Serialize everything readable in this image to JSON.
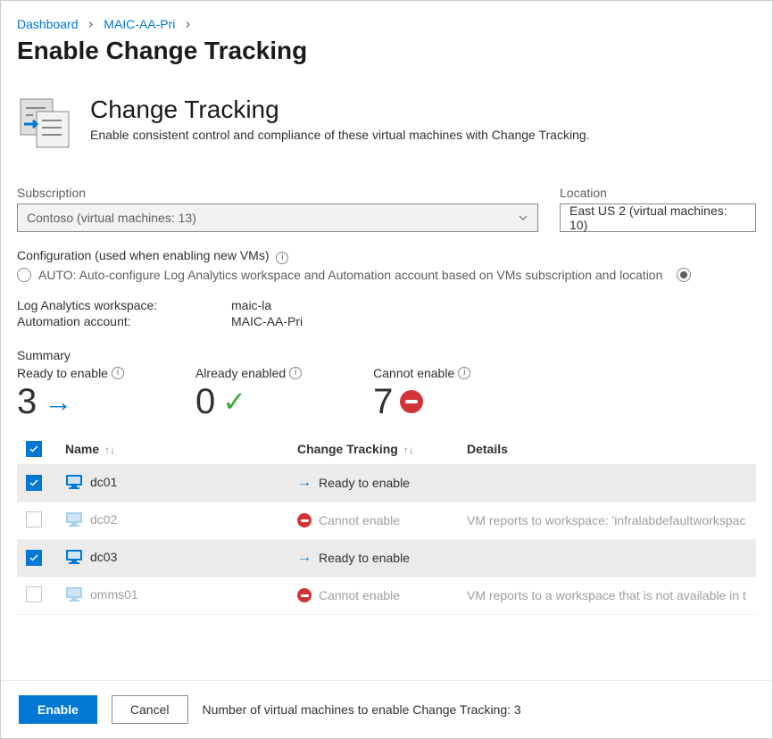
{
  "breadcrumb": {
    "item0": "Dashboard",
    "item1": "MAIC-AA-Pri"
  },
  "pageTitle": "Enable Change Tracking",
  "hero": {
    "title": "Change Tracking",
    "subtitle": "Enable consistent control and compliance of these virtual machines with Change Tracking."
  },
  "fields": {
    "subscription": {
      "label": "Subscription",
      "value": "Contoso  (virtual machines: 13)"
    },
    "location": {
      "label": "Location",
      "value": "East US 2 (virtual machines: 10)"
    }
  },
  "config": {
    "title": "Configuration (used when enabling new VMs)",
    "option": "AUTO: Auto-configure Log Analytics workspace and Automation account based on VMs subscription and location"
  },
  "info": {
    "law_label": "Log Analytics workspace:",
    "law_value": "maic-la",
    "aa_label": "Automation account:",
    "aa_value": "MAIC-AA-Pri"
  },
  "summary": {
    "heading": "Summary",
    "ready": {
      "label": "Ready to enable",
      "value": "3"
    },
    "already": {
      "label": "Already enabled",
      "value": "0"
    },
    "cannot": {
      "label": "Cannot enable",
      "value": "7"
    }
  },
  "table": {
    "col_name": "Name",
    "col_ct": "Change Tracking",
    "col_details": "Details",
    "rows": [
      {
        "name": "dc01",
        "status": "Ready to enable",
        "details": "",
        "checked": true,
        "enabled": true
      },
      {
        "name": "dc02",
        "status": "Cannot enable",
        "details": "VM reports to workspace: 'infralabdefaultworkspac",
        "checked": false,
        "enabled": false
      },
      {
        "name": "dc03",
        "status": "Ready to enable",
        "details": "",
        "checked": true,
        "enabled": true
      },
      {
        "name": "omms01",
        "status": "Cannot enable",
        "details": "VM reports to a workspace that is not available in t",
        "checked": false,
        "enabled": false
      }
    ]
  },
  "footer": {
    "enable": "Enable",
    "cancel": "Cancel",
    "count_text": "Number of virtual machines to enable Change Tracking: 3"
  }
}
